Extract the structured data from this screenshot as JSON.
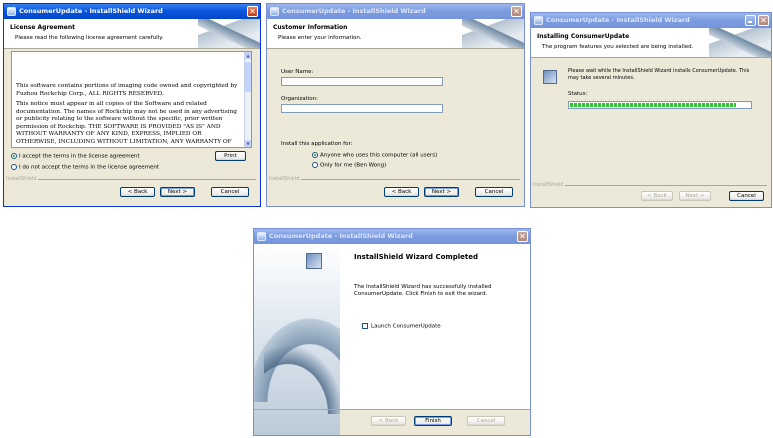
{
  "windows": {
    "license": {
      "title": "ConsumerUpdate - InstallShield Wizard",
      "header_title": "License Agreement",
      "header_subtitle": "Please read the following license agreement carefully.",
      "paragraphs": [
        "This software contains portions of imaging code owned and copyrighted by Fuzhou Rockchip Corp., ALL RIGHTS RESERVED.",
        "This notice must appear in all copies of the Software and related documentation. The names of Rockchip may not be used in any advertising or publicity relating to the software without the specific, prior written permission of Rockchip. THE SOFTWARE IS PROVIDED \"AS IS\" AND WITHOUT WARRANTY OF ANY KIND, EXPRESS, IMPLIED OR OTHERWISE, INCLUDING WITHOUT LIMITATION, ANY WARRANTY OF"
      ],
      "accept_label": "I accept the terms in the license agreement",
      "decline_label": "I do not accept the terms in the license agreement",
      "print_label": "Print",
      "brand": "InstallShield",
      "back_label": "< Back",
      "next_label": "Next >",
      "cancel_label": "Cancel"
    },
    "customer": {
      "title": "ConsumerUpdate - InstallShield Wizard",
      "header_title": "Customer Information",
      "header_subtitle": "Please enter your information.",
      "user_name_label": "User Name:",
      "organization_label": "Organization:",
      "install_for_label": "Install this application for:",
      "anyone_label": "Anyone who uses this computer (all users)",
      "only_me_label": "Only for me (Ben Wong)",
      "brand": "InstallShield",
      "back_label": "< Back",
      "next_label": "Next >",
      "cancel_label": "Cancel"
    },
    "installing": {
      "title": "ConsumerUpdate - InstallShield Wizard",
      "header_title": "Installing ConsumerUpdate",
      "header_subtitle": "The program features you selected are being installed.",
      "message": "Please wait while the InstallShield Wizard installs ConsumerUpdate. This may take several minutes.",
      "status_label": "Status:",
      "progress": 0.92,
      "brand": "InstallShield",
      "back_label": "< Back",
      "next_label": "Next >",
      "cancel_label": "Cancel"
    },
    "completed": {
      "title": "ConsumerUpdate - InstallShield Wizard",
      "heading": "InstallShield Wizard Completed",
      "message": "The InstallShield Wizard has successfully installed ConsumerUpdate. Click Finish to exit the wizard.",
      "launch_label": "Launch ConsumerUpdate",
      "back_label": "< Back",
      "finish_label": "Finish",
      "cancel_label": "Cancel"
    }
  }
}
